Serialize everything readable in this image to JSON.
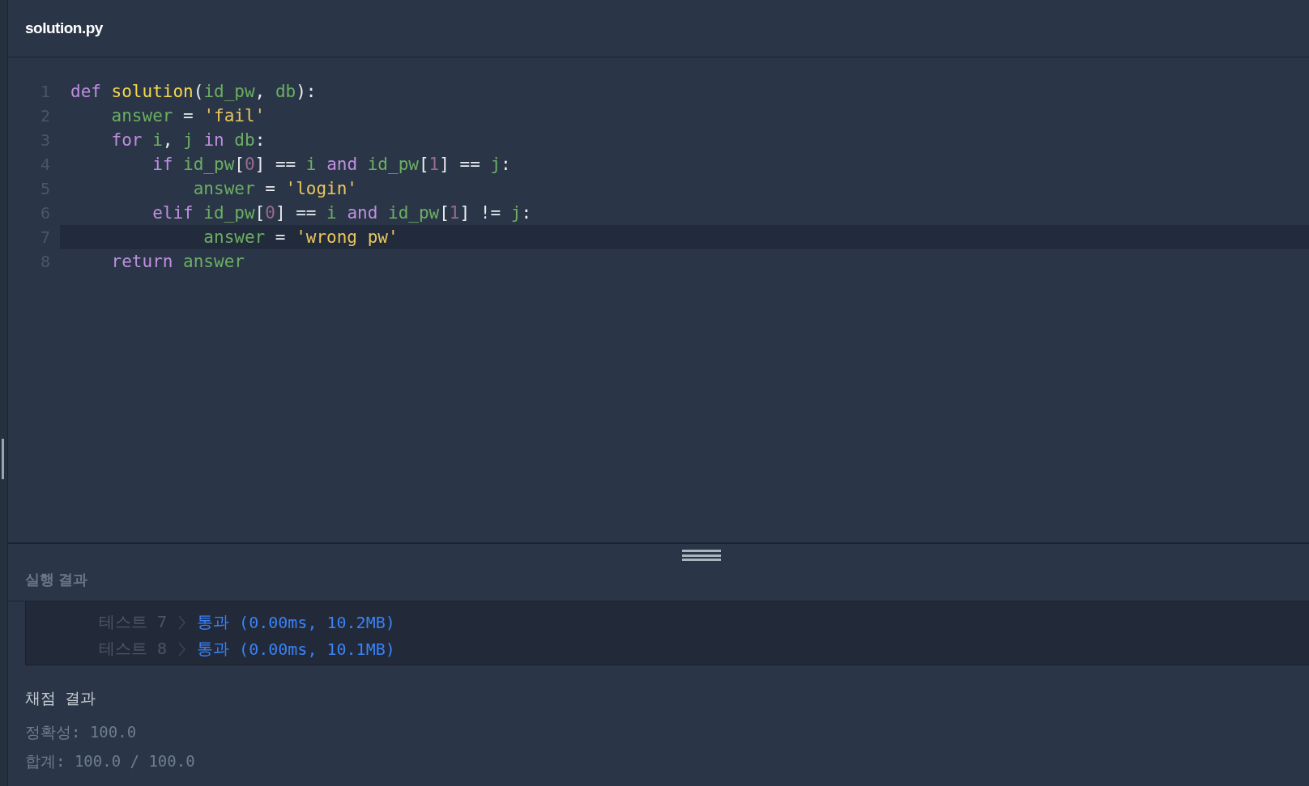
{
  "file_tab": {
    "title": "solution.py"
  },
  "code_lines": [
    {
      "number": "1",
      "current": false,
      "tokens": [
        {
          "kind": "keyword",
          "text": "def"
        },
        {
          "kind": "function",
          "text": " solution"
        },
        {
          "kind": "punct",
          "text": "("
        },
        {
          "kind": "name",
          "text": "id_pw"
        },
        {
          "kind": "punct",
          "text": ", "
        },
        {
          "kind": "name",
          "text": "db"
        },
        {
          "kind": "punct",
          "text": "):"
        }
      ]
    },
    {
      "number": "2",
      "current": false,
      "tokens": [
        {
          "kind": "name",
          "text": "    answer"
        },
        {
          "kind": "punct",
          "text": " = "
        },
        {
          "kind": "string",
          "text": "'fail'"
        }
      ]
    },
    {
      "number": "3",
      "current": false,
      "tokens": [
        {
          "kind": "keyword",
          "text": "    for"
        },
        {
          "kind": "name",
          "text": " i"
        },
        {
          "kind": "punct",
          "text": ", "
        },
        {
          "kind": "name",
          "text": "j"
        },
        {
          "kind": "keyword",
          "text": " in"
        },
        {
          "kind": "name",
          "text": " db"
        },
        {
          "kind": "punct",
          "text": ":"
        }
      ]
    },
    {
      "number": "4",
      "current": false,
      "tokens": [
        {
          "kind": "keyword",
          "text": "        if"
        },
        {
          "kind": "name",
          "text": " id_pw"
        },
        {
          "kind": "punct",
          "text": "["
        },
        {
          "kind": "number",
          "text": "0"
        },
        {
          "kind": "punct",
          "text": "] == "
        },
        {
          "kind": "name",
          "text": "i"
        },
        {
          "kind": "keyword",
          "text": " and"
        },
        {
          "kind": "name",
          "text": " id_pw"
        },
        {
          "kind": "punct",
          "text": "["
        },
        {
          "kind": "number",
          "text": "1"
        },
        {
          "kind": "punct",
          "text": "] == "
        },
        {
          "kind": "name",
          "text": "j"
        },
        {
          "kind": "punct",
          "text": ":"
        }
      ]
    },
    {
      "number": "5",
      "current": false,
      "tokens": [
        {
          "kind": "name",
          "text": "            answer"
        },
        {
          "kind": "punct",
          "text": " = "
        },
        {
          "kind": "string",
          "text": "'login'"
        }
      ]
    },
    {
      "number": "6",
      "current": false,
      "tokens": [
        {
          "kind": "keyword",
          "text": "        elif"
        },
        {
          "kind": "name",
          "text": " id_pw"
        },
        {
          "kind": "punct",
          "text": "["
        },
        {
          "kind": "number",
          "text": "0"
        },
        {
          "kind": "punct",
          "text": "] == "
        },
        {
          "kind": "name",
          "text": "i"
        },
        {
          "kind": "keyword",
          "text": " and"
        },
        {
          "kind": "name",
          "text": " id_pw"
        },
        {
          "kind": "punct",
          "text": "["
        },
        {
          "kind": "number",
          "text": "1"
        },
        {
          "kind": "punct",
          "text": "] != "
        },
        {
          "kind": "name",
          "text": "j"
        },
        {
          "kind": "punct",
          "text": ":"
        }
      ]
    },
    {
      "number": "7",
      "current": true,
      "tokens": [
        {
          "kind": "name",
          "text": "             answer"
        },
        {
          "kind": "punct",
          "text": " = "
        },
        {
          "kind": "string",
          "text": "'wrong pw'"
        }
      ]
    },
    {
      "number": "8",
      "current": false,
      "tokens": [
        {
          "kind": "keyword",
          "text": "    return"
        },
        {
          "kind": "name",
          "text": " answer"
        }
      ]
    }
  ],
  "results_panel": {
    "title": "실행 결과",
    "tests": [
      {
        "label": "테스트 7",
        "status": "통과",
        "detail": "(0.00ms, 10.2MB)"
      },
      {
        "label": "테스트 8",
        "status": "통과",
        "detail": "(0.00ms, 10.1MB)"
      }
    ],
    "grading": {
      "title": "채점 결과",
      "accuracy": "정확성: 100.0",
      "total": "합계: 100.0 / 100.0"
    }
  }
}
